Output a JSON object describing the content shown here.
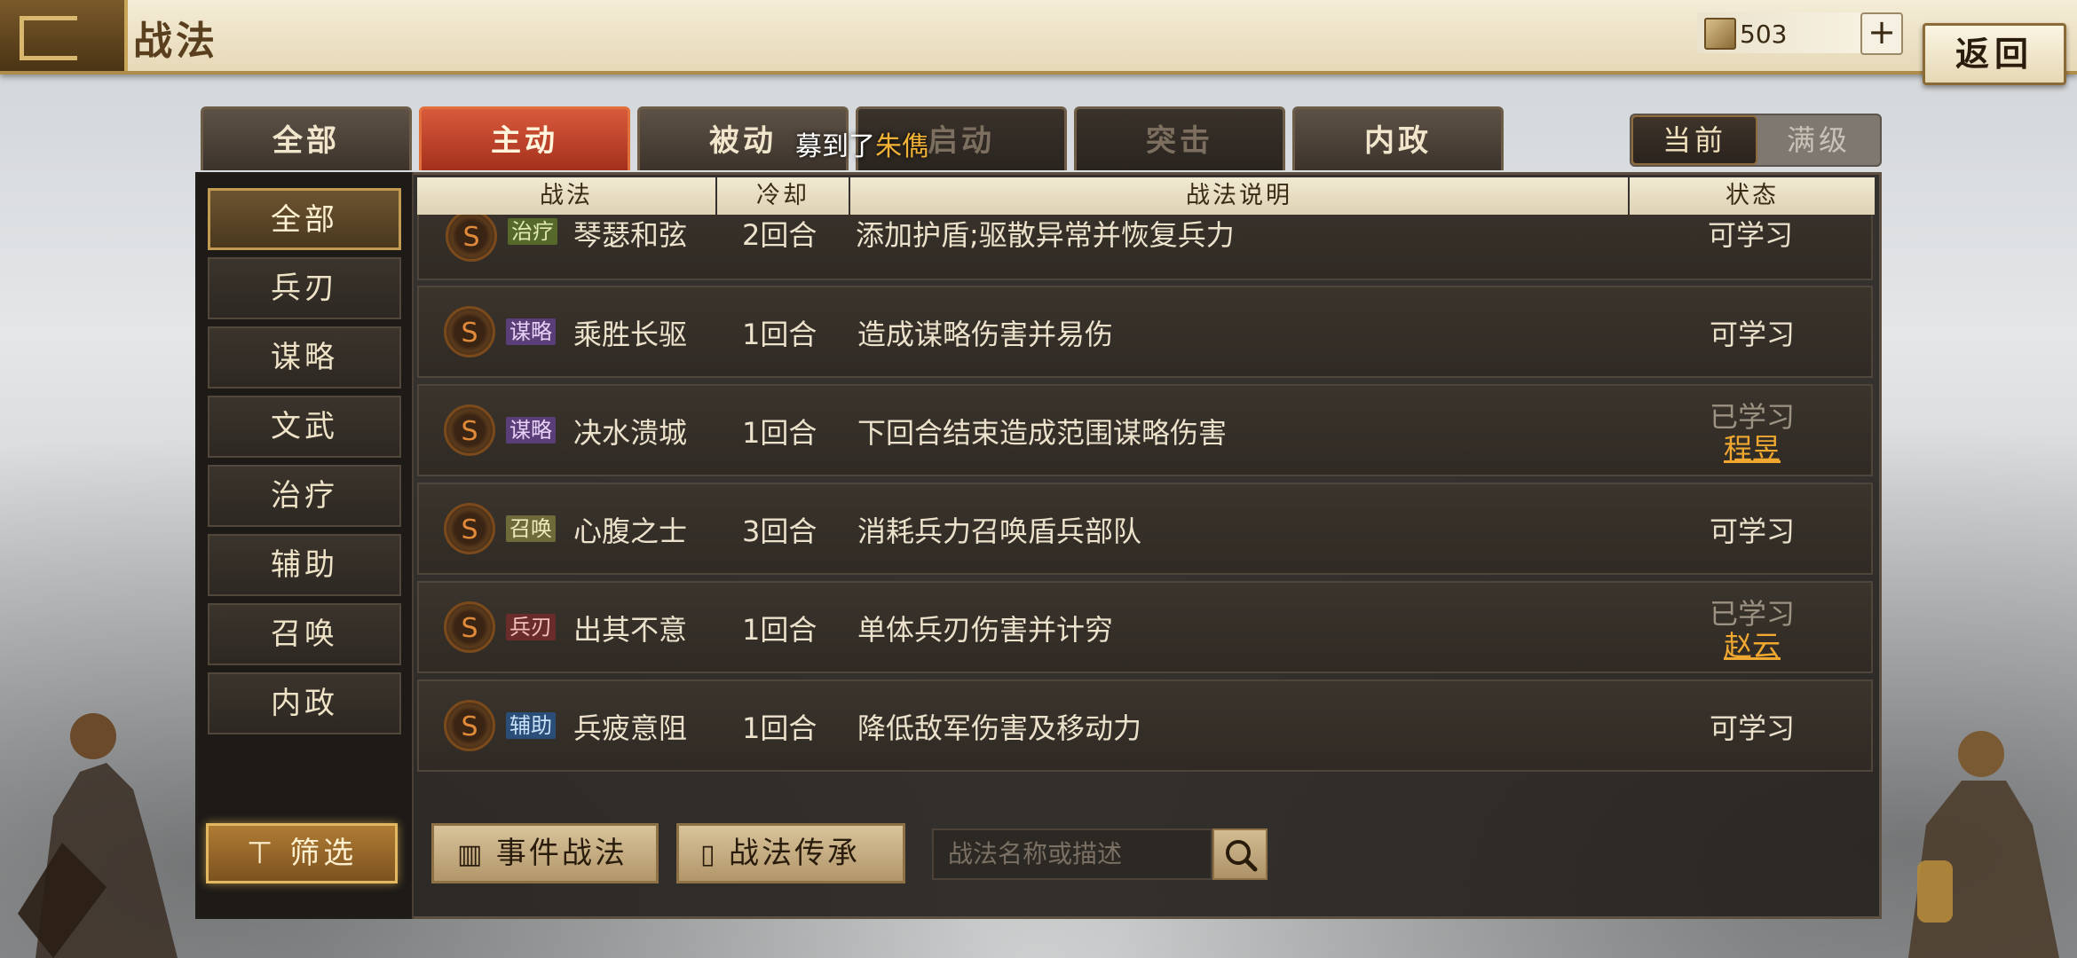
{
  "header": {
    "title": "战法",
    "currency": "503",
    "add_label": "+",
    "back_label": "返回"
  },
  "tabs": [
    {
      "label": "全部"
    },
    {
      "label": "主动"
    },
    {
      "label": "被动"
    },
    {
      "label": "启动"
    },
    {
      "label": "突击"
    },
    {
      "label": "内政"
    }
  ],
  "toast": {
    "prefix": "募到了",
    "name": "朱儁"
  },
  "level_toggle": {
    "current": "当前",
    "max": "满级"
  },
  "sidebar": {
    "items": [
      {
        "label": "全部"
      },
      {
        "label": "兵刃"
      },
      {
        "label": "谋略"
      },
      {
        "label": "文武"
      },
      {
        "label": "治疗"
      },
      {
        "label": "辅助"
      },
      {
        "label": "召唤"
      },
      {
        "label": "内政"
      }
    ],
    "filter_label": "筛选"
  },
  "table": {
    "headers": {
      "name": "战法",
      "cooldown": "冷却",
      "desc": "战法说明",
      "status": "状态"
    },
    "rows": [
      {
        "grade": "S",
        "tag": "治疗",
        "name": "琴瑟和弦",
        "cooldown": "2回合",
        "desc": "添加护盾;驱散异常并恢复兵力",
        "status": "可学习",
        "learner": ""
      },
      {
        "grade": "S",
        "tag": "谋略",
        "name": "乘胜长驱",
        "cooldown": "1回合",
        "desc": "造成谋略伤害并易伤",
        "status": "可学习",
        "learner": ""
      },
      {
        "grade": "S",
        "tag": "谋略",
        "name": "决水溃城",
        "cooldown": "1回合",
        "desc": "下回合结束造成范围谋略伤害",
        "status": "已学习",
        "learner": "程昱"
      },
      {
        "grade": "S",
        "tag": "召唤",
        "name": "心腹之士",
        "cooldown": "3回合",
        "desc": "消耗兵力召唤盾兵部队",
        "status": "可学习",
        "learner": ""
      },
      {
        "grade": "S",
        "tag": "兵刃",
        "name": "出其不意",
        "cooldown": "1回合",
        "desc": "单体兵刃伤害并计穷",
        "status": "已学习",
        "learner": "赵云"
      },
      {
        "grade": "S",
        "tag": "辅助",
        "name": "兵疲意阻",
        "cooldown": "1回合",
        "desc": "降低敌军伤害及移动力",
        "status": "可学习",
        "learner": ""
      }
    ]
  },
  "bottom": {
    "event_label": "事件战法",
    "inherit_label": "战法传承",
    "search_placeholder": "战法名称或描述"
  }
}
